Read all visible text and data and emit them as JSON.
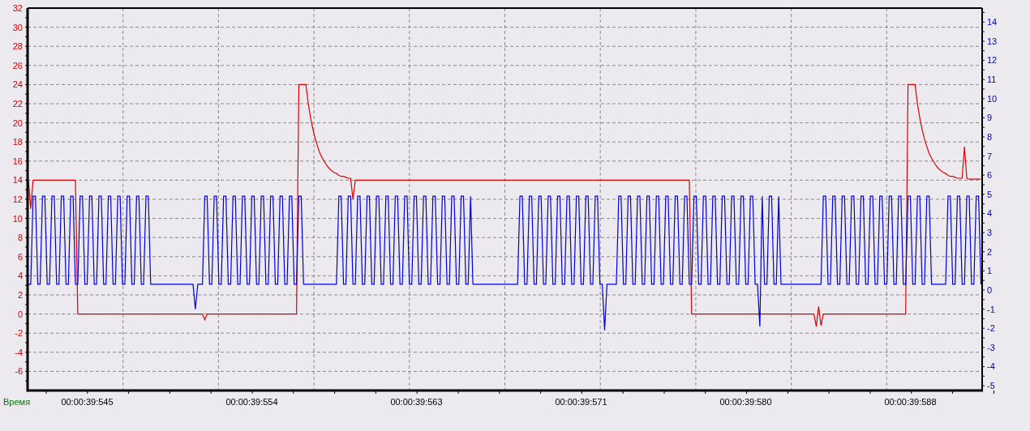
{
  "chart": {
    "chart_data": {
      "type": "line",
      "xlabel": "Время",
      "ylim": [
        -8,
        32
      ],
      "categories": [
        null,
        null,
        null,
        null,
        null,
        null,
        null,
        null,
        null,
        null,
        null,
        null,
        null,
        null,
        null,
        null,
        null,
        null,
        null,
        null,
        null,
        null,
        null,
        null,
        null,
        "00:00:39:545",
        null,
        null,
        null,
        null,
        null,
        null,
        null,
        null,
        null,
        null,
        null,
        null,
        null,
        null,
        null,
        null,
        null,
        null,
        null,
        null,
        null,
        null,
        null,
        null,
        null,
        null,
        null,
        null,
        null,
        null,
        null,
        null,
        null,
        null,
        null,
        null,
        null,
        null,
        null,
        null,
        null,
        null,
        null,
        null,
        null,
        null,
        null,
        null,
        null,
        null,
        null,
        null,
        null,
        null,
        null,
        null,
        null,
        null,
        null,
        null,
        null,
        null,
        null,
        null,
        null,
        null,
        null,
        null,
        null,
        "00:00:39:554",
        null,
        null,
        null,
        null,
        null,
        null,
        null,
        null,
        null,
        null,
        null,
        null,
        null,
        null,
        null,
        null,
        null,
        null,
        null,
        null,
        null,
        null,
        null,
        null,
        null,
        null,
        null,
        null,
        null,
        null,
        null,
        null,
        null,
        null,
        null,
        null,
        null,
        null,
        null,
        null,
        null,
        null,
        null,
        null,
        null,
        null,
        null,
        null,
        null,
        null,
        null,
        null,
        null,
        null,
        null,
        null,
        null,
        null,
        null,
        null,
        null,
        null,
        null,
        null,
        null,
        null,
        null,
        null,
        null,
        "00:00:39:563",
        null,
        null,
        null,
        null,
        null,
        null,
        null,
        null,
        null,
        null,
        null,
        null,
        null,
        null,
        null,
        null,
        null,
        null,
        null,
        null,
        null,
        null,
        null,
        null,
        null,
        null,
        null,
        null,
        null,
        null,
        null,
        null,
        null,
        null,
        null,
        null,
        null,
        null,
        null,
        null,
        null,
        null,
        null,
        null,
        null,
        null,
        null,
        null,
        null,
        null,
        null,
        null,
        null,
        null,
        null,
        null,
        null,
        null,
        null,
        null,
        null,
        null,
        null,
        null,
        null,
        null,
        null,
        null,
        null,
        "00:00:39:571",
        null,
        null,
        null,
        null,
        null,
        null,
        null,
        null,
        null,
        null,
        null,
        null,
        null,
        null,
        null,
        null,
        null,
        null,
        null,
        null,
        null,
        null,
        null,
        null,
        null,
        null,
        null,
        null,
        null,
        null,
        null,
        null,
        null,
        null,
        null,
        null,
        null,
        null,
        null,
        null,
        null,
        null,
        null,
        null,
        null,
        null,
        null,
        null,
        null,
        null,
        null,
        null,
        null,
        null,
        null,
        null,
        null,
        null,
        null,
        null,
        null,
        null,
        null,
        null,
        null,
        null,
        null,
        null,
        null,
        "00:00:39:580",
        null,
        null,
        null,
        null,
        null,
        null,
        null,
        null,
        null,
        null,
        null,
        null,
        null,
        null,
        null,
        null,
        null,
        null,
        null,
        null,
        null,
        null,
        null,
        null,
        null,
        null,
        null,
        null,
        null,
        null,
        null,
        null,
        null,
        null,
        null,
        null,
        null,
        null,
        null,
        null,
        null,
        null,
        null,
        null,
        null,
        null,
        null,
        null,
        null,
        null,
        null,
        null,
        null,
        null,
        null,
        null,
        null,
        null,
        null,
        null,
        null,
        null,
        null,
        null,
        null,
        null,
        null,
        null,
        null,
        "00:00:39:588",
        null,
        null,
        null,
        null,
        null,
        null,
        null,
        null,
        null,
        null,
        null,
        null,
        null,
        null,
        null,
        null,
        null,
        null,
        null,
        null,
        null,
        null,
        null,
        null,
        null,
        null,
        null,
        null,
        null,
        null
      ],
      "yticks": [
        32,
        30,
        28,
        26,
        24,
        22,
        20,
        18,
        16,
        14,
        12,
        10,
        8,
        6,
        4,
        2,
        0,
        -2,
        -4,
        -6
      ],
      "y2lim": [
        -5.25,
        14.73
      ],
      "y2ticks": [
        14,
        13,
        12,
        11,
        10,
        9,
        8,
        7,
        6,
        5,
        4,
        3,
        2,
        1,
        0,
        -1,
        -2,
        -3,
        -4,
        -5
      ],
      "grid": true,
      "series": [
        {
          "color": "#dd0000",
          "values": [
            14,
            11,
            14,
            14,
            14,
            14,
            14,
            14,
            14,
            14,
            14,
            14,
            14,
            14,
            14,
            14,
            14,
            14,
            14,
            14,
            14,
            0,
            0,
            0,
            0,
            0,
            0,
            0,
            0,
            0,
            0,
            0,
            0,
            0,
            0,
            0,
            0,
            0,
            0,
            0,
            0,
            0,
            0,
            0,
            0,
            0,
            0,
            0,
            0,
            0,
            0,
            0,
            0,
            0,
            0,
            0,
            0,
            0,
            0,
            0,
            0,
            0,
            0,
            0,
            0,
            0,
            0,
            0,
            0,
            0,
            0,
            0,
            0,
            0,
            0,
            -0.6,
            0,
            0,
            0,
            0,
            0,
            0,
            0,
            0,
            0,
            0,
            0,
            0,
            0,
            0,
            0,
            0,
            0,
            0,
            0,
            0,
            0,
            0,
            0,
            0,
            0,
            0,
            0,
            0,
            0,
            0,
            0,
            0,
            0,
            0,
            0,
            0,
            0,
            0,
            0,
            24,
            24,
            24,
            24,
            22.0,
            20.5,
            19.3,
            18.3,
            17.5,
            16.8,
            16.3,
            15.9,
            15.5,
            15.2,
            15.0,
            14.8,
            14.7,
            14.5,
            14.4,
            14.4,
            14.3,
            14.2,
            14.2,
            12,
            14,
            14,
            14,
            14,
            14,
            14,
            14,
            14,
            14,
            14,
            14,
            14,
            14,
            14,
            14,
            14,
            14,
            14,
            14,
            14,
            14,
            14,
            14,
            14,
            14,
            14,
            14,
            14,
            14,
            14,
            14,
            14,
            14,
            14,
            14,
            14,
            14,
            14,
            14,
            14,
            14,
            14,
            14,
            14,
            14,
            14,
            14,
            14,
            14,
            14,
            14,
            14,
            14,
            14,
            14,
            14,
            14,
            14,
            14,
            14,
            14,
            14,
            14,
            14,
            14,
            14,
            14,
            14,
            14,
            14,
            14,
            14,
            14,
            14,
            14,
            14,
            14,
            14,
            14,
            14,
            14,
            14,
            14,
            14,
            14,
            14,
            14,
            14,
            14,
            14,
            14,
            14,
            14,
            14,
            14,
            14,
            14,
            14,
            14,
            14,
            14,
            14,
            14,
            14,
            14,
            14,
            14,
            14,
            14,
            14,
            14,
            14,
            14,
            14,
            14,
            14,
            14,
            14,
            14,
            14,
            14,
            14,
            14,
            14,
            14,
            14,
            14,
            14,
            14,
            14,
            14,
            14,
            14,
            14,
            14,
            14,
            14,
            14,
            14,
            14,
            14,
            14,
            14,
            0,
            0,
            0,
            0,
            0,
            0,
            0,
            0,
            0,
            0,
            0,
            0,
            0,
            0,
            0,
            0,
            0,
            0,
            0,
            0,
            0,
            0,
            0,
            0,
            0,
            0,
            0,
            0,
            0,
            0,
            0,
            0,
            0,
            0,
            0,
            0,
            0,
            0,
            0,
            0,
            0,
            0,
            0,
            0,
            0,
            0,
            0,
            0,
            0,
            0,
            0,
            0,
            0,
            -1.3,
            0.8,
            -1.2,
            0,
            0,
            0,
            0,
            0,
            0,
            0,
            0,
            0,
            0,
            0,
            0,
            0,
            0,
            0,
            0,
            0,
            0,
            0,
            0,
            0,
            0,
            0,
            0,
            0,
            0,
            0,
            0,
            0,
            0,
            0,
            0,
            0,
            0,
            0,
            0,
            24,
            24,
            24,
            24,
            22.0,
            20.5,
            19.3,
            18.3,
            17.5,
            16.8,
            16.3,
            15.9,
            15.5,
            15.2,
            15.0,
            14.8,
            14.7,
            14.5,
            14.4,
            14.4,
            14.3,
            14.2,
            14.2,
            14.2,
            17.5,
            14.2,
            14.1,
            14.1,
            14.1,
            14.1,
            14.1,
            14.1
          ]
        },
        {
          "color": "#0000dd",
          "axis": "y2",
          "values": [
            0.3,
            0.3,
            4.9,
            4.9,
            0.3,
            0.3,
            4.9,
            4.9,
            0.3,
            0.3,
            4.9,
            4.9,
            0.3,
            0.3,
            4.9,
            4.9,
            0.3,
            0.3,
            4.9,
            4.9,
            0.3,
            0.3,
            4.9,
            4.9,
            0.3,
            0.3,
            4.9,
            4.9,
            0.3,
            0.3,
            4.9,
            4.9,
            0.3,
            0.3,
            4.9,
            4.9,
            0.3,
            0.3,
            4.9,
            4.9,
            0.3,
            0.3,
            4.9,
            4.9,
            0.3,
            0.3,
            4.9,
            4.9,
            0.3,
            0.3,
            4.9,
            4.9,
            0.3,
            0.3,
            0.3,
            0.3,
            0.3,
            0.3,
            0.3,
            0.3,
            0.3,
            0.3,
            0.3,
            0.3,
            0.3,
            0.3,
            0.3,
            0.3,
            0.3,
            0.3,
            0.3,
            -1,
            0.3,
            0.3,
            0.3,
            4.9,
            4.9,
            0.3,
            0.3,
            4.9,
            4.9,
            0.3,
            0.3,
            4.9,
            4.9,
            0.3,
            0.3,
            4.9,
            4.9,
            0.3,
            0.3,
            4.9,
            4.9,
            0.3,
            0.3,
            4.9,
            4.9,
            0.3,
            0.3,
            4.9,
            4.9,
            0.3,
            0.3,
            4.9,
            4.9,
            0.3,
            0.3,
            4.9,
            4.9,
            0.3,
            0.3,
            4.9,
            4.9,
            0.3,
            0.3,
            4.9,
            4.9,
            0.3,
            0.3,
            0.3,
            0.3,
            0.3,
            0.3,
            0.3,
            0.3,
            0.3,
            0.3,
            0.3,
            0.3,
            0.3,
            0.3,
            0.3,
            4.9,
            4.9,
            0.3,
            0.3,
            4.9,
            4.9,
            0.3,
            0.3,
            4.9,
            4.9,
            0.3,
            0.3,
            4.9,
            4.9,
            0.3,
            0.3,
            4.9,
            4.9,
            0.3,
            0.3,
            4.9,
            4.9,
            0.3,
            0.3,
            4.9,
            4.9,
            0.3,
            0.3,
            4.9,
            4.9,
            0.3,
            0.3,
            4.9,
            4.9,
            0.3,
            0.3,
            4.9,
            4.9,
            0.3,
            0.3,
            4.9,
            4.9,
            0.3,
            0.3,
            4.9,
            4.9,
            0.3,
            0.3,
            4.9,
            4.9,
            0.3,
            0.3,
            4.9,
            4.9,
            0.3,
            0.3,
            4.9,
            0.3,
            0.3,
            0.3,
            0.3,
            0.3,
            0.3,
            0.3,
            0.3,
            0.3,
            0.3,
            0.3,
            0.3,
            0.3,
            0.3,
            0.3,
            0.3,
            0.3,
            0.3,
            0.3,
            0.3,
            4.9,
            4.9,
            0.3,
            0.3,
            4.9,
            4.9,
            0.3,
            0.3,
            4.9,
            4.9,
            0.3,
            0.3,
            4.9,
            4.9,
            0.3,
            0.3,
            4.9,
            4.9,
            0.3,
            0.3,
            4.9,
            4.9,
            0.3,
            0.3,
            4.9,
            4.9,
            0.3,
            0.3,
            4.9,
            4.9,
            0.3,
            0.3,
            4.9,
            4.9,
            0.3,
            0.3,
            -2.1,
            0.3,
            0.3,
            0.3,
            0.3,
            0.3,
            4.9,
            4.9,
            0.3,
            0.3,
            4.9,
            4.9,
            0.3,
            0.3,
            4.9,
            4.9,
            0.3,
            0.3,
            4.9,
            4.9,
            0.3,
            0.3,
            4.9,
            4.9,
            0.3,
            0.3,
            4.9,
            4.9,
            0.3,
            0.3,
            4.9,
            4.9,
            0.3,
            0.3,
            4.9,
            4.9,
            0.3,
            0.3,
            4.9,
            4.9,
            0.3,
            0.3,
            4.9,
            4.9,
            0.3,
            0.3,
            4.9,
            4.9,
            0.3,
            0.3,
            4.9,
            4.9,
            0.3,
            0.3,
            4.9,
            4.9,
            0.3,
            0.3,
            4.9,
            4.9,
            0.3,
            0.3,
            4.9,
            4.9,
            0.3,
            0.3,
            -1.9,
            4.9,
            0.3,
            0.3,
            4.9,
            4.9,
            0.3,
            0.3,
            4.9,
            0.3,
            0.3,
            0.3,
            0.3,
            0.3,
            0.3,
            0.3,
            0.3,
            0.3,
            0.3,
            0.3,
            0.3,
            0.3,
            0.3,
            0.3,
            0.3,
            0.3,
            0.3,
            4.9,
            4.9,
            0.3,
            0.3,
            4.9,
            4.9,
            0.3,
            0.3,
            4.9,
            4.9,
            0.3,
            0.3,
            4.9,
            4.9,
            0.3,
            0.3,
            4.9,
            4.9,
            0.3,
            0.3,
            4.9,
            4.9,
            0.3,
            0.3,
            4.9,
            4.9,
            0.3,
            0.3,
            4.9,
            4.9,
            0.3,
            0.3,
            4.9,
            4.9,
            0.3,
            0.3,
            4.9,
            4.9,
            0.3,
            0.3,
            4.9,
            4.9,
            0.3,
            0.3,
            4.9,
            4.9,
            0.3,
            0.3,
            0.3,
            0.3,
            0.3,
            0.3,
            0.3,
            4.9,
            4.9,
            0.3,
            0.3,
            4.9,
            4.9,
            0.3,
            0.3,
            4.9,
            4.9,
            0.3,
            0.3,
            4.9,
            4.9,
            0.3
          ]
        }
      ]
    }
  }
}
